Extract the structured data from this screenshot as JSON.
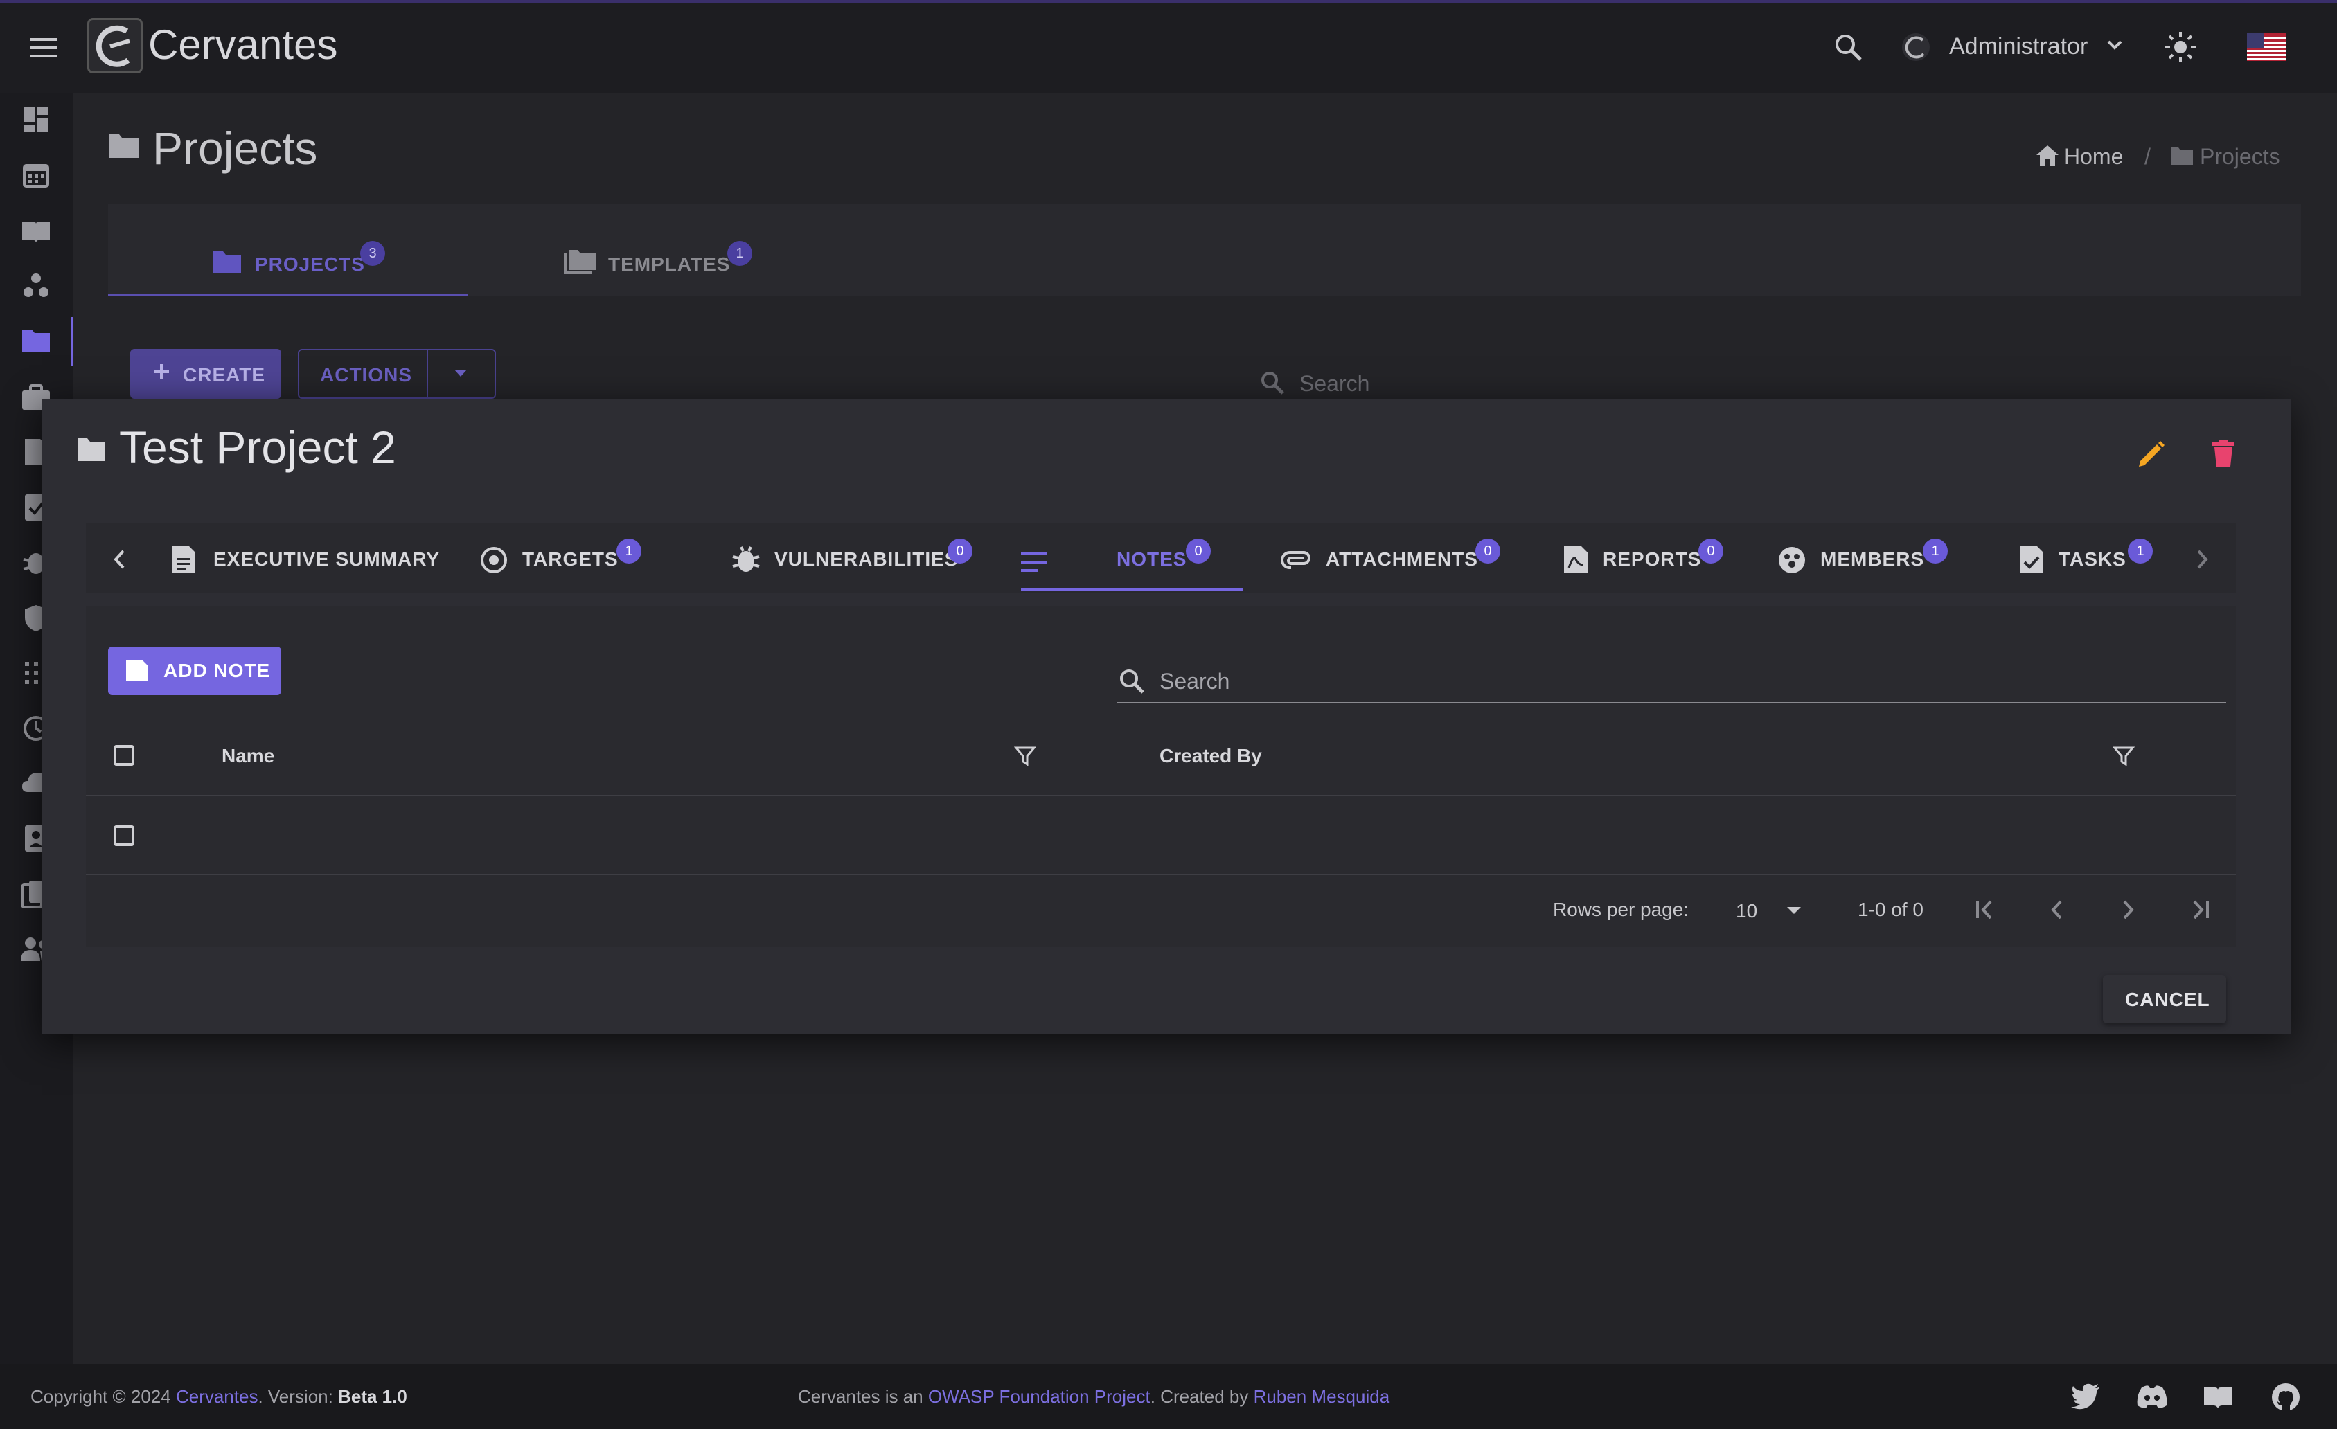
{
  "app": {
    "name": "Cervantes",
    "user_name": "Administrator"
  },
  "page": {
    "title": "Projects",
    "breadcrumb": {
      "home": "Home",
      "separator": "/",
      "current": "Projects"
    }
  },
  "background_tabs": [
    {
      "label": "PROJECTS",
      "count": "3",
      "active": true
    },
    {
      "label": "TEMPLATES",
      "count": "1",
      "active": false
    }
  ],
  "background_toolbar": {
    "create_label": "CREATE",
    "actions_label": "ACTIONS",
    "search_placeholder": "Search"
  },
  "dialog": {
    "title": "Test Project 2",
    "tabs": [
      {
        "label": "EXECUTIVE SUMMARY",
        "count": ""
      },
      {
        "label": "TARGETS",
        "count": "1"
      },
      {
        "label": "VULNERABILITIES",
        "count": "0"
      },
      {
        "label": "NOTES",
        "count": "0"
      },
      {
        "label": "ATTACHMENTS",
        "count": "0"
      },
      {
        "label": "REPORTS",
        "count": "0"
      },
      {
        "label": "MEMBERS",
        "count": "1"
      },
      {
        "label": "TASKS",
        "count": "1"
      }
    ],
    "add_note_label": "ADD NOTE",
    "search_placeholder": "Search",
    "table": {
      "columns": [
        "Name",
        "Created By"
      ]
    },
    "pagination": {
      "rows_per_page_label": "Rows per page:",
      "rows_per_page_value": "10",
      "range_text": "1-0 of 0"
    },
    "cancel_label": "CANCEL"
  },
  "footer": {
    "copyright_prefix": "Copyright © 2024",
    "brand": "Cervantes",
    "version_prefix": ". Version:",
    "version": "Beta 1.0",
    "owasp_prefix": "Cervantes is an",
    "owasp_link": "OWASP Foundation Project",
    "created_by_prefix": ". Created by",
    "author": "Ruben Mesquida"
  },
  "colors": {
    "accent": "#7566e0",
    "edit": "#f5a623",
    "delete": "#e8436e"
  }
}
